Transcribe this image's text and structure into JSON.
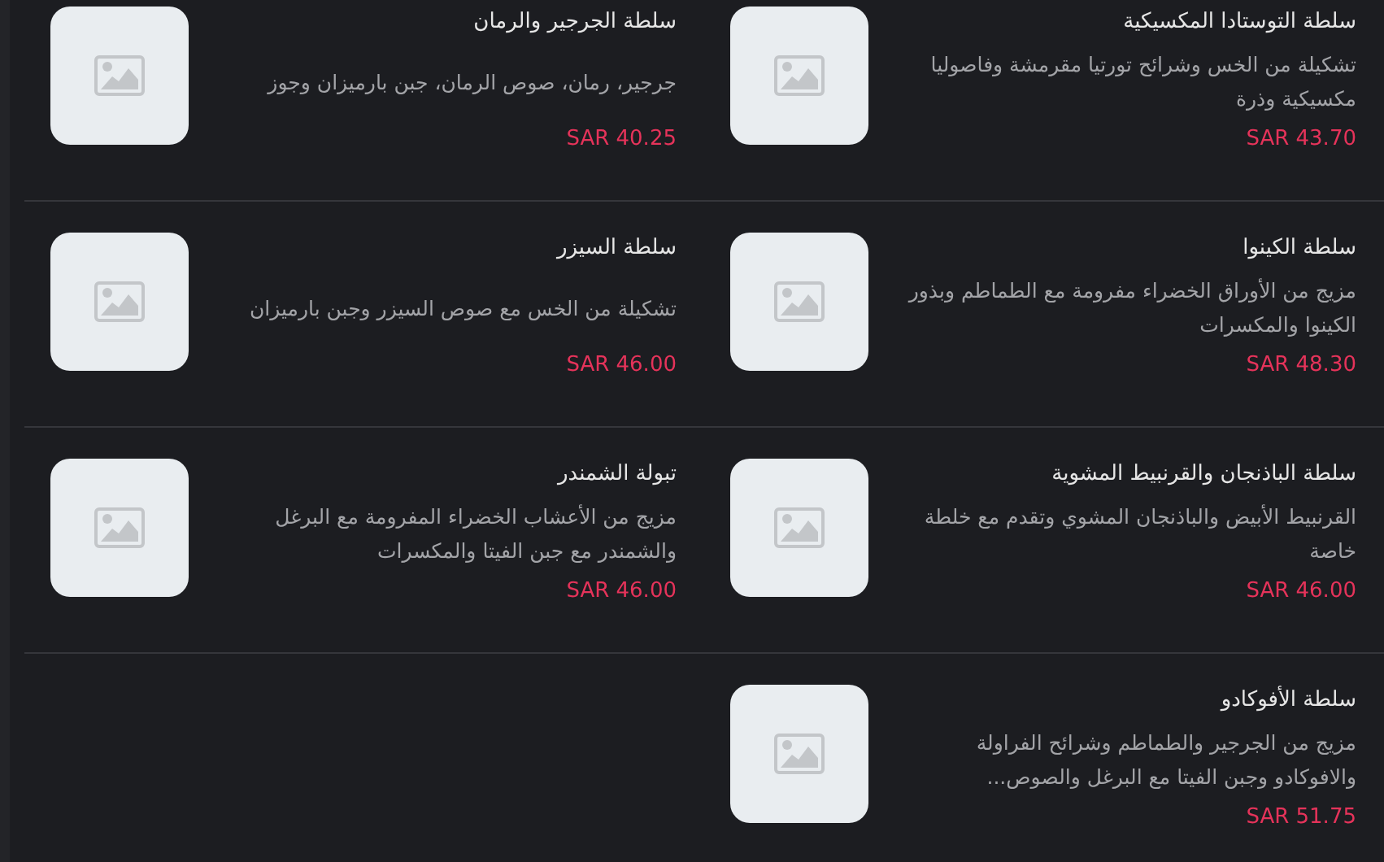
{
  "items": [
    {
      "title": "سلطة التوستادا المكسيكية",
      "description": "تشكيلة من الخس وشرائح تورتيا مقرمشة وفاصوليا مكسيكية وذرة",
      "price": "SAR 43.70"
    },
    {
      "title": "سلطة الجرجير والرمان",
      "description": "جرجير، رمان، صوص الرمان، جبن بارميزان وجوز",
      "price": "SAR 40.25"
    },
    {
      "title": "سلطة الكينوا",
      "description": "مزيج من الأوراق الخضراء مفرومة مع الطماطم وبذور الكينوا والمكسرات",
      "price": "SAR 48.30"
    },
    {
      "title": "سلطة السيزر",
      "description": "تشكيلة من الخس مع صوص السيزر وجبن بارميزان",
      "price": "SAR 46.00"
    },
    {
      "title": "سلطة الباذنجان والقرنبيط المشوية",
      "description": "القرنبيط الأبيض والباذنجان المشوي وتقدم مع خلطة خاصة",
      "price": "SAR 46.00"
    },
    {
      "title": "تبولة الشمندر",
      "description": "مزيج من الأعشاب الخضراء المفرومة مع البرغل والشمندر مع جبن الفيتا والمكسرات",
      "price": "SAR 46.00"
    },
    {
      "title": "سلطة الأفوكادو",
      "description": "مزيج من الجرجير والطماطم وشرائح الفراولة والافوكادو وجبن الفيتا مع البرغل والصوص...",
      "price": "SAR 51.75"
    }
  ]
}
